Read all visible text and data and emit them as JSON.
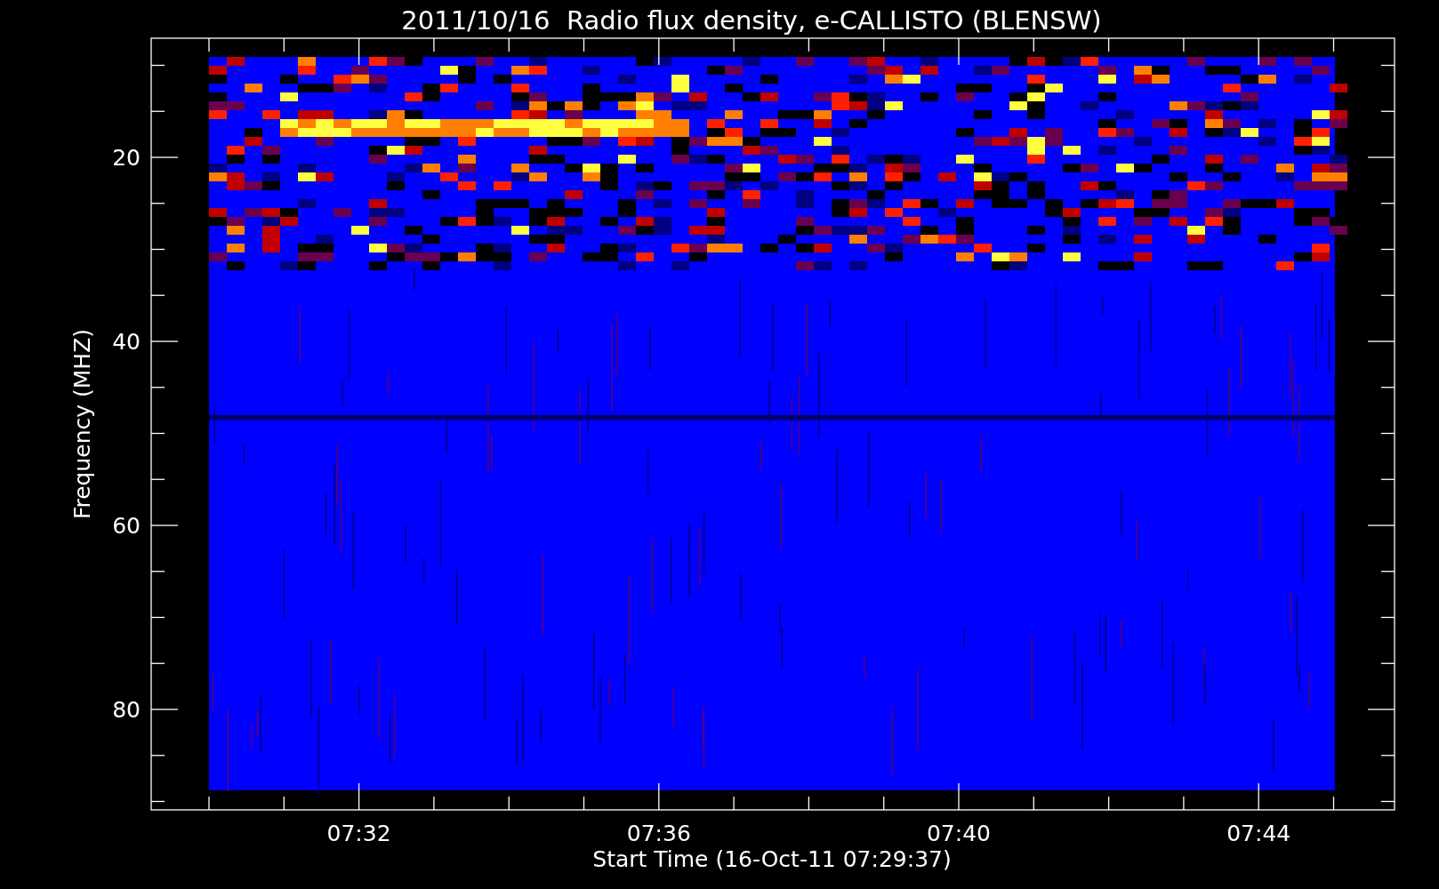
{
  "title": "2011/10/16  Radio flux density, e-CALLISTO (BLENSW)",
  "y_axis": {
    "label": "Frequency (MHZ)",
    "ticks": [
      "20",
      "40",
      "60",
      "80"
    ]
  },
  "x_axis": {
    "label": "Start Time (16-Oct-11 07:29:37)",
    "ticks": [
      "07:32",
      "07:36",
      "07:40",
      "07:44"
    ]
  }
}
